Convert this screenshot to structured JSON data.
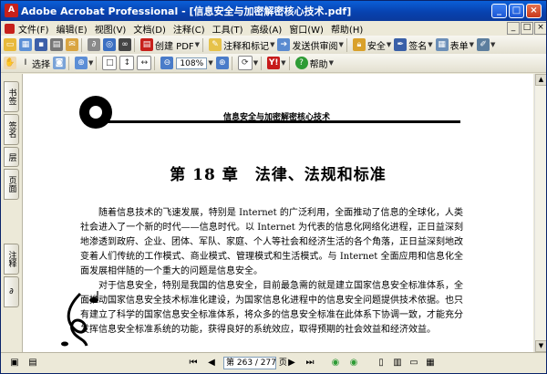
{
  "window": {
    "title": "Adobe Acrobat Professional - [信息安全与加密解密核心技术.pdf]"
  },
  "menu": [
    "文件(F)",
    "编辑(E)",
    "视图(V)",
    "文档(D)",
    "注释(C)",
    "工具(T)",
    "高级(A)",
    "窗口(W)",
    "帮助(H)"
  ],
  "toolbar1": {
    "create_pdf": "创建 PDF",
    "comment_markup": "注释和标记",
    "send_review": "发送供审阅",
    "security": "安全",
    "sign": "签名",
    "forms": "表单"
  },
  "toolbar2": {
    "select": "选择",
    "zoom_value": "108%",
    "help": "帮助"
  },
  "nav_tabs": {
    "bookmarks": "书签",
    "signatures": "签名",
    "layers": "层",
    "pages": "页面",
    "comments": "注释"
  },
  "document": {
    "running_header": "信息安全与加密解密核心技术",
    "chapter_title": "第 18 章　法律、法规和标准",
    "paragraphs": [
      "随着信息技术的飞速发展，特别是 Internet 的广泛利用，全面推动了信息的全球化，人类社会进入了一个新的时代——信息时代。以 Internet 为代表的信息化网络化进程，正日益深刻地渗透到政府、企业、团体、军队、家庭、个人等社会和经济生活的各个角落，正日益深刻地改变着人们传统的工作模式、商业模式、管理模式和生活模式。与 Internet 全面应用和信息化全面发展相伴随的一个重大的问题是信息安全。",
      "对于信息安全，特别是我国的信息安全，目前最急需的就是建立国家信息安全标准体系，全面推动国家信息安全技术标准化建设，为国家信息化进程中的信息安全问题提供技术依据。也只有建立了科学的国家信息安全标准体系，将众多的信息安全标准在此体系下协调一致，才能充分发挥信息安全标准系统的功能，获得良好的系统效应，取得预期的社会效益和经济效益。"
    ]
  },
  "status": {
    "page_display": "第 263 / 277 页"
  },
  "colors": {
    "title_bar": "#0842b0",
    "chrome": "#ece9d8",
    "pdf_logo": "#c7201b"
  }
}
